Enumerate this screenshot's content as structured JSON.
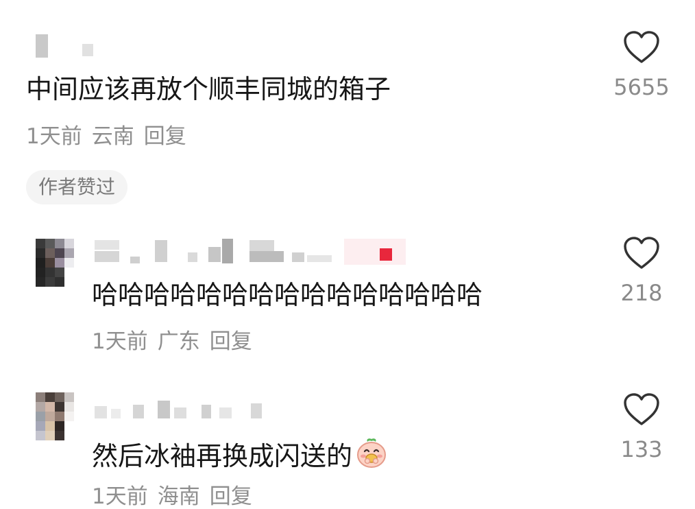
{
  "comments": [
    {
      "text": "中间应该再放个顺丰同城的箱子",
      "time": "1天前",
      "location": "云南",
      "reply_label": "回复",
      "likes": "5655",
      "badge": "作者赞过"
    },
    {
      "text": "哈哈哈哈哈哈哈哈哈哈哈哈哈哈哈",
      "time": "1天前",
      "location": "广东",
      "reply_label": "回复",
      "likes": "218"
    },
    {
      "text": "然后冰袖再换成闪送的",
      "time": "1天前",
      "location": "海南",
      "reply_label": "回复",
      "likes": "133",
      "emoji": "peach-face-emoji"
    }
  ],
  "colors": {
    "text": "#161616",
    "meta": "#8f8f8f",
    "badge_bg": "#f4f4f4",
    "heart_stroke": "#333333",
    "badge_red": "#e8273c"
  },
  "icons": [
    "heart-outline-icon",
    "peach-face-emoji"
  ]
}
